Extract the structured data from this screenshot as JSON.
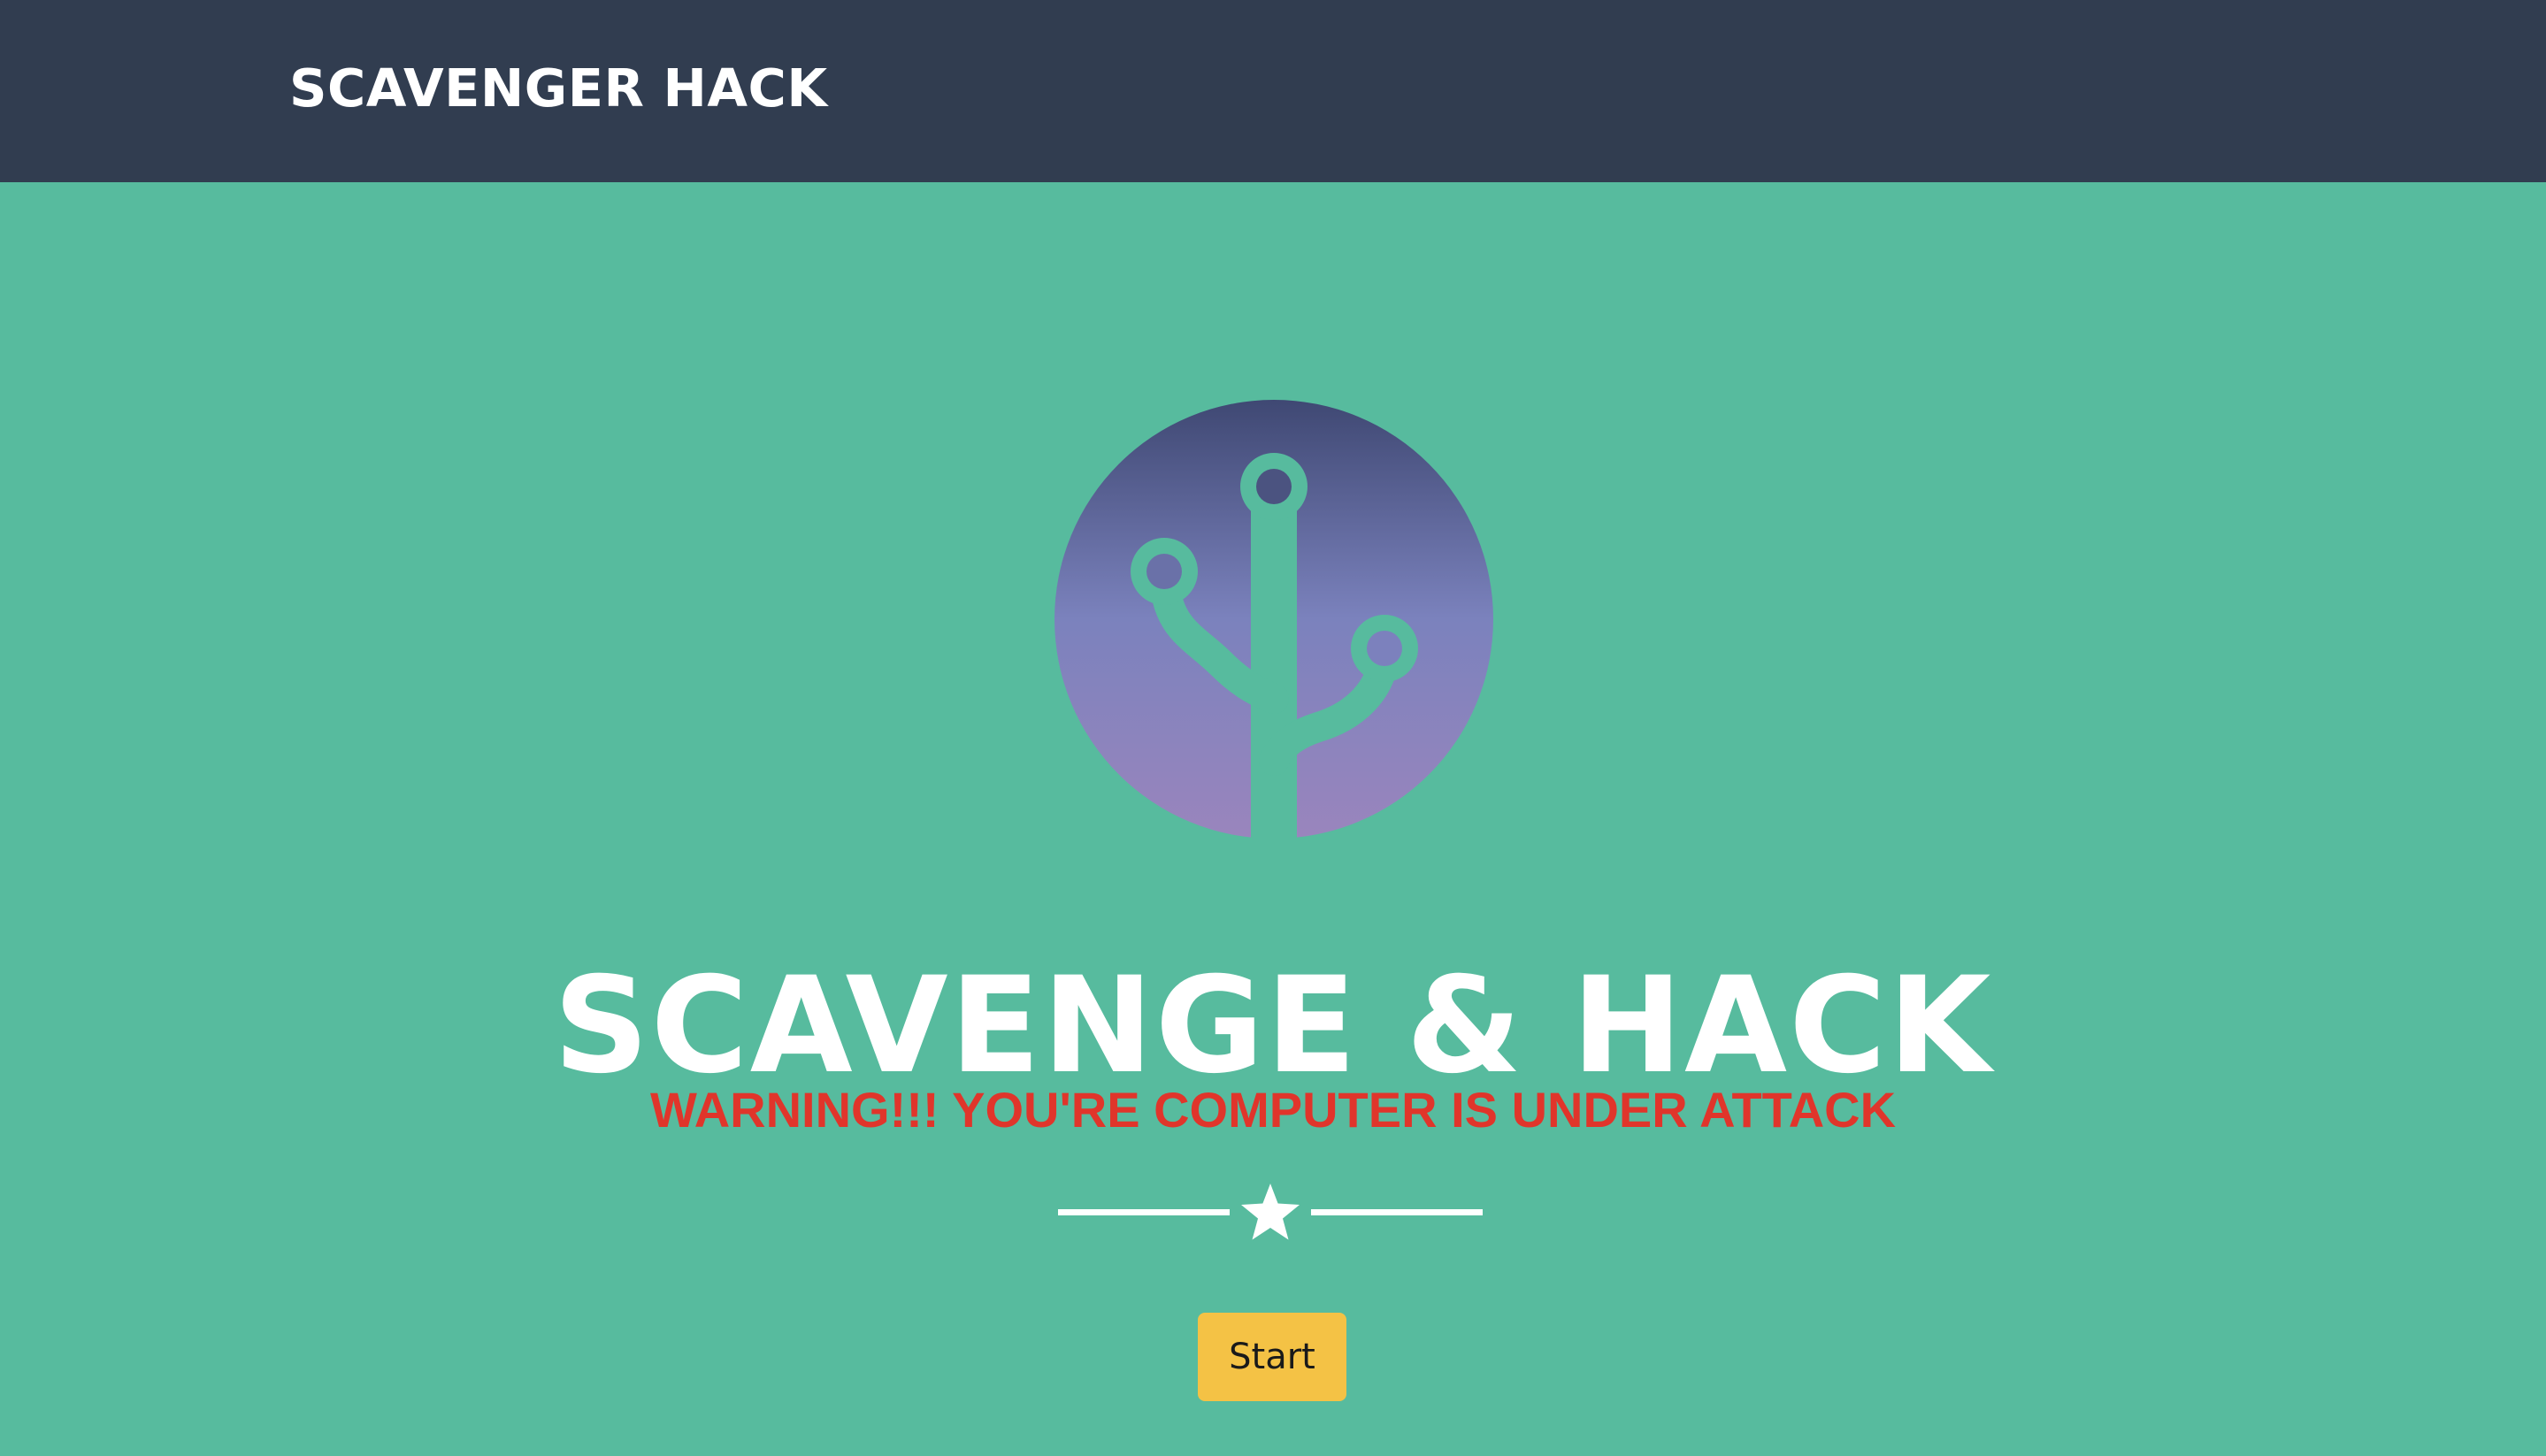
{
  "navbar": {
    "brand": "SCAVENGER HACK"
  },
  "hero": {
    "logo_icon": "circuit-tree-icon",
    "title": "SCAVENGE & HACK",
    "warning": "WARNING!!! YOU'RE COMPUTER IS UNDER ATTACK",
    "divider_icon": "star-icon",
    "start_label": "Start"
  },
  "colors": {
    "navbar_bg": "#313d50",
    "page_bg": "#57bb9e",
    "title_text": "#ffffff",
    "warning_text": "#e0352b",
    "button_bg": "#f4c245",
    "logo_gradient_top": "#3f4873",
    "logo_gradient_mid": "#7b82bd",
    "logo_gradient_bottom": "#9a85bd"
  }
}
